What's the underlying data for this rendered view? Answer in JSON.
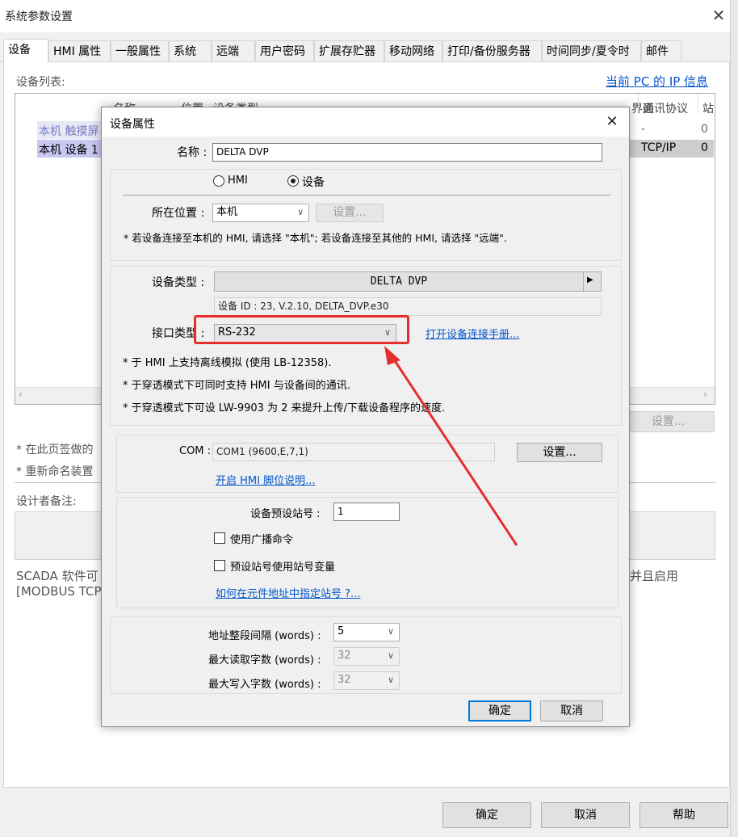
{
  "window": {
    "title": "系统参数设置"
  },
  "tabs": [
    "设备",
    "HMI 属性",
    "一般属性",
    "系统",
    "远端",
    "用户密码",
    "扩展存贮器",
    "移动网络",
    "打印/备份服务器",
    "时间同步/夏令时",
    "邮件"
  ],
  "device_list": {
    "label": "设备列表:",
    "pc_ip_link": "当前 PC 的 IP 信息",
    "columns": [
      "名称",
      "位置",
      "设备类型",
      "界面",
      "通讯协议",
      "站"
    ],
    "rows": [
      {
        "name": "本机 触摸屏",
        "iface": "-",
        "station": "0"
      },
      {
        "name": "本机 设备 1",
        "protocol": "TCP/IP",
        "station": "0"
      }
    ],
    "side_button": "设置..."
  },
  "notes": {
    "note1": "* 在此页签做的",
    "note2": "* 重新命名装置",
    "designer_label": "设计者备注:",
    "scada_left": "SCADA 软件可",
    "scada_left2": "[MODBUS TCP",
    "scada_right": "并且启用"
  },
  "footer": {
    "ok": "确定",
    "cancel": "取消",
    "help": "帮助"
  },
  "dialog": {
    "title": "设备属性",
    "name_label": "名称 :",
    "name_value": "DELTA DVP",
    "radio_hmi": "HMI",
    "radio_device": "设备",
    "location_label": "所在位置 :",
    "location_value": "本机",
    "location_btn": "设置...",
    "location_note": "* 若设备连接至本机的 HMI, 请选择 \"本机\"; 若设备连接至其他的 HMI, 请选择 \"远端\".",
    "type_label": "设备类型 :",
    "type_value": "DELTA DVP",
    "type_info": "设备 ID : 23, V.2.10, DELTA_DVP.e30",
    "iface_label": "接口类型 :",
    "iface_value": "RS-232",
    "manual_link": "打开设备连接手册...",
    "iface_note1": "* 于 HMI 上支持离线模拟 (使用 LB-12358).",
    "iface_note2": "* 于穿透模式下可同时支持 HMI 与设备间的通讯.",
    "iface_note3": "* 于穿透模式下可设 LW-9903 为 2 来提升上传/下载设备程序的速度.",
    "com_label": "COM :",
    "com_value": "COM1 (9600,E,7,1)",
    "com_btn": "设置...",
    "pin_link": "开启 HMI 脚位说明...",
    "station_label": "设备预设站号 :",
    "station_value": "1",
    "broadcast_label": "使用广播命令",
    "station_var_label": "预设站号使用站号变量",
    "station_help_link": "如何在元件地址中指定站号 ?...",
    "addr_gap_label": "地址整段间隔 (words) :",
    "addr_gap_value": "5",
    "max_read_label": "最大读取字数 (words) :",
    "max_read_value": "32",
    "max_write_label": "最大写入字数 (words) :",
    "max_write_value": "32",
    "ok": "确定",
    "cancel": "取消"
  },
  "colors": {
    "highlight": "#e52e2e",
    "link": "#0055cc",
    "focus": "#0078d7"
  }
}
